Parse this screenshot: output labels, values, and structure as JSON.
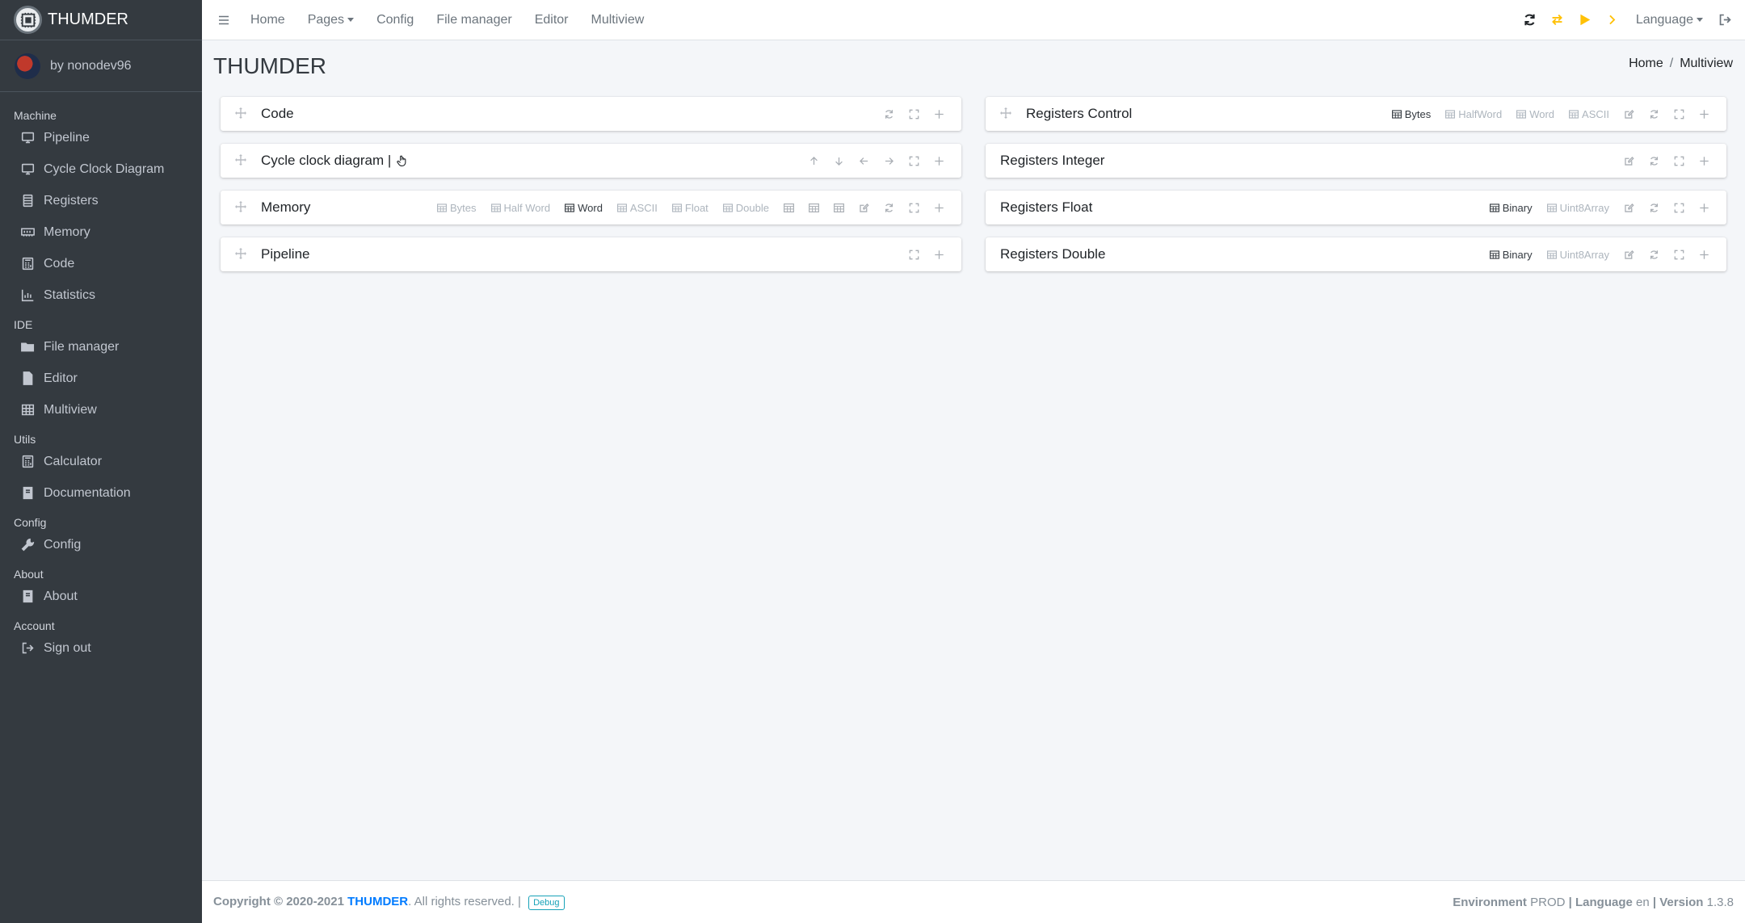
{
  "brand": {
    "name": "THUMDER"
  },
  "user": {
    "name": "by nonodev96"
  },
  "sidebar": {
    "sections": [
      {
        "header": "Machine",
        "items": [
          {
            "label": "Pipeline",
            "icon": "desktop-icon"
          },
          {
            "label": "Cycle Clock Diagram",
            "icon": "desktop-icon"
          },
          {
            "label": "Registers",
            "icon": "registers-icon"
          },
          {
            "label": "Memory",
            "icon": "memory-icon"
          },
          {
            "label": "Code",
            "icon": "calculator-icon"
          },
          {
            "label": "Statistics",
            "icon": "chart-icon"
          }
        ]
      },
      {
        "header": "IDE",
        "items": [
          {
            "label": "File manager",
            "icon": "folder-open-icon"
          },
          {
            "label": "Editor",
            "icon": "file-icon"
          },
          {
            "label": "Multiview",
            "icon": "table-icon"
          }
        ]
      },
      {
        "header": "Utils",
        "items": [
          {
            "label": "Calculator",
            "icon": "calculator-icon"
          },
          {
            "label": "Documentation",
            "icon": "book-icon"
          }
        ]
      },
      {
        "header": "Config",
        "items": [
          {
            "label": "Config",
            "icon": "wrench-icon"
          }
        ]
      },
      {
        "header": "About",
        "items": [
          {
            "label": "About",
            "icon": "book-icon"
          }
        ]
      },
      {
        "header": "Account",
        "items": [
          {
            "label": "Sign out",
            "icon": "sign-out-icon"
          }
        ]
      }
    ]
  },
  "topnav": {
    "links": [
      "Home",
      "Pages",
      "Config",
      "File manager",
      "Editor",
      "Multiview"
    ],
    "language": "Language",
    "colors": {
      "sync": "#212529",
      "accent": "#ffc107"
    }
  },
  "page": {
    "title": "THUMDER"
  },
  "breadcrumb": {
    "home": "Home",
    "current": "Multiview"
  },
  "cards": {
    "code": {
      "title": "Code"
    },
    "cycle": {
      "title": "Cycle clock diagram |"
    },
    "memory": {
      "title": "Memory",
      "views": [
        "Bytes",
        "Half Word",
        "Word",
        "ASCII",
        "Float",
        "Double"
      ],
      "active": "Word"
    },
    "pipeline": {
      "title": "Pipeline"
    },
    "reg_control": {
      "title": "Registers Control",
      "views": [
        "Bytes",
        "HalfWord",
        "Word",
        "ASCII"
      ],
      "active": "Bytes"
    },
    "reg_integer": {
      "title": "Registers Integer"
    },
    "reg_float": {
      "title": "Registers Float",
      "views": [
        "Binary",
        "Uint8Array"
      ],
      "active": "Binary"
    },
    "reg_double": {
      "title": "Registers Double",
      "views": [
        "Binary",
        "Uint8Array"
      ],
      "active": "Binary"
    }
  },
  "footer": {
    "copyright_prefix": "Copyright © 2020-2021",
    "brand": "THUMDER",
    "rights": ". All rights reserved. |",
    "debug": "Debug",
    "env_label": "Environment",
    "env_value": "PROD",
    "lang_label": "Language",
    "lang_value": "en",
    "version_label": "Version",
    "version_value": "1.3.8",
    "sep": "|"
  }
}
